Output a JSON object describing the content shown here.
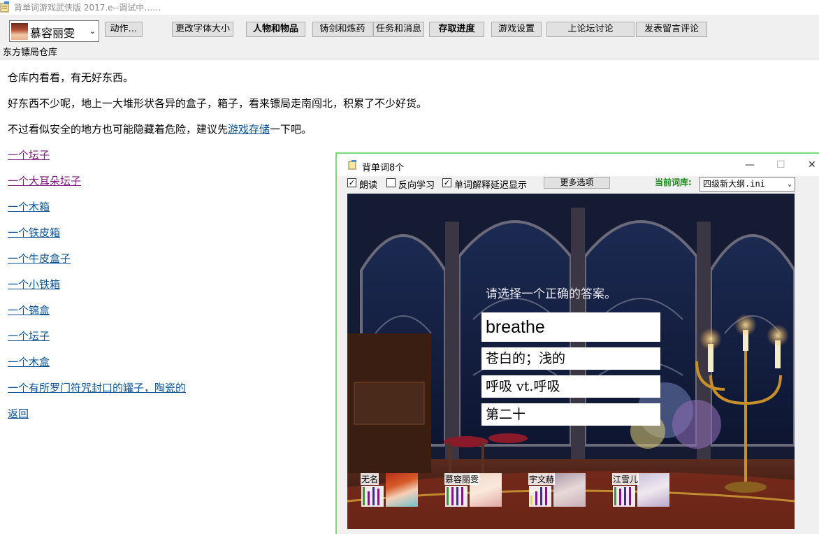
{
  "window": {
    "title": "背单词游戏武侠版 2017.e--调试中……"
  },
  "toolbar": {
    "character": "慕容丽雯",
    "action_label": "动作…",
    "buttons": [
      "更改字体大小",
      "人物和物品",
      "铸剑和炼药",
      "任务和消息",
      "存取进度",
      "游戏设置",
      "上论坛讨论",
      "发表留言评论"
    ]
  },
  "location": "东方镖局仓库",
  "main": {
    "p1": "仓库内看看，有无好东西。",
    "p2": "好东西不少呢，地上一大堆形状各异的盒子，箱子，看来镖局走南闯北，积累了不少好货。",
    "p3_before": "不过看似安全的地方也可能隐藏着危险，建议先",
    "p3_link": "游戏存储",
    "p3_after": "一下吧。",
    "items": [
      "一个坛子",
      "一个大耳朵坛子",
      "一个木箱",
      "一个铁皮箱",
      "一个牛皮盒子",
      "一个小铁箱",
      "一个锦盒",
      "一个坛子",
      "一个木盒",
      "一个有所罗门符咒封口的罐子，陶瓷的"
    ],
    "back": "返回"
  },
  "word_window": {
    "title": "背单词8个",
    "controls": {
      "minimize": "—",
      "maximize": "☐",
      "close": "✕"
    },
    "options": [
      {
        "label": "朗读",
        "checked": true
      },
      {
        "label": "反向学习",
        "checked": false
      },
      {
        "label": "单词解释延迟显示",
        "checked": true
      }
    ],
    "more_button": "更多选项",
    "dict_label": "当前词库:",
    "dict_value": "四级新大纲.ini",
    "prompt": "请选择一个正确的答案。",
    "word": "breathe",
    "choices": [
      "苍白的；浅的",
      "呼吸 vt.呼吸",
      "第二十"
    ]
  },
  "party": [
    {
      "name": "无名"
    },
    {
      "name": "慕容丽雯"
    },
    {
      "name": "宇文赫"
    },
    {
      "name": "江雪儿"
    }
  ],
  "colors": {
    "link": "#0b5394",
    "visited_link": "#7b1f7b",
    "window_border": "#7ad97a",
    "dict_label": "#1a8a1a"
  }
}
